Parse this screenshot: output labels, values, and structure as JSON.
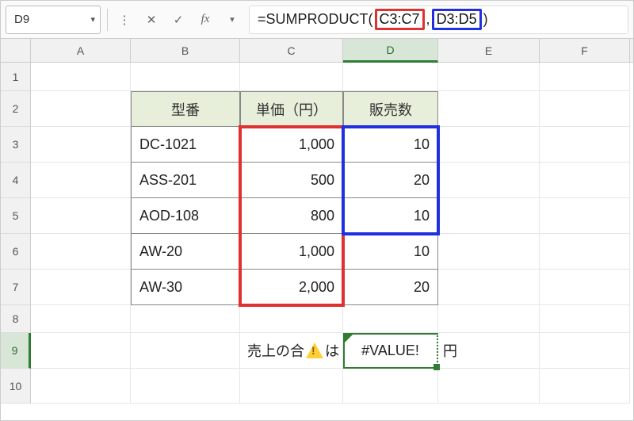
{
  "namebox": {
    "value": "D9"
  },
  "formula": {
    "prefix": "=SUMPRODUCT(",
    "ref1": "C3:C7",
    "sep": ",",
    "ref2": "D3:D5",
    "suffix": ")"
  },
  "columns": {
    "A": "A",
    "B": "B",
    "C": "C",
    "D": "D",
    "E": "E",
    "F": "F"
  },
  "rowlabels": {
    "1": "1",
    "2": "2",
    "3": "3",
    "4": "4",
    "5": "5",
    "6": "6",
    "7": "7",
    "8": "8",
    "9": "9",
    "10": "10"
  },
  "headers": {
    "model": "型番",
    "unit_price": "単価（円）",
    "sales_qty": "販売数"
  },
  "table": [
    {
      "model": "DC-1021",
      "price": "1,000",
      "qty": "10"
    },
    {
      "model": "ASS-201",
      "price": "500",
      "qty": "20"
    },
    {
      "model": "AOD-108",
      "price": "800",
      "qty": "10"
    },
    {
      "model": "AW-20",
      "price": "1,000",
      "qty": "10"
    },
    {
      "model": "AW-30",
      "price": "2,000",
      "qty": "20"
    }
  ],
  "summary": {
    "label_prefix": "売上の合",
    "label_suffix": "は",
    "value": "#VALUE!",
    "unit": "円"
  },
  "chart_data": {
    "type": "table",
    "note": "SUMPRODUCT with mismatched array sizes producing #VALUE! error",
    "columns": [
      "型番",
      "単価（円）",
      "販売数"
    ],
    "rows": [
      [
        "DC-1021",
        1000,
        10
      ],
      [
        "ASS-201",
        500,
        20
      ],
      [
        "AOD-108",
        800,
        10
      ],
      [
        "AW-20",
        1000,
        10
      ],
      [
        "AW-30",
        2000,
        20
      ]
    ],
    "formula": "=SUMPRODUCT(C3:C7,D3:D5)",
    "result": "#VALUE!"
  }
}
